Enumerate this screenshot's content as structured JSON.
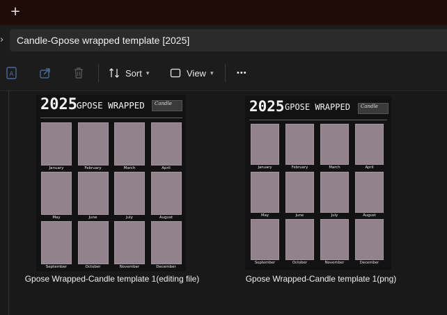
{
  "window": {
    "new_tab_glyph": "+"
  },
  "address": {
    "path": "Candle-Gpose wrapped template [2025]",
    "chevron": "›"
  },
  "toolbar": {
    "icons": [
      "ai-rename-icon",
      "share-icon",
      "delete-icon"
    ],
    "sort_label": "Sort",
    "view_label": "View",
    "more_label": "•••"
  },
  "files": [
    {
      "name": "Gpose Wrapped-Candle template 1(editing file)",
      "thumb": {
        "year": "2025",
        "title": "GPOSE WRAPPED",
        "stamp": "Candle",
        "months": [
          "January",
          "February",
          "March",
          "April",
          "May",
          "June",
          "July",
          "August",
          "September",
          "October",
          "November",
          "December"
        ]
      }
    },
    {
      "name": "Gpose Wrapped-Candle template 1(png)",
      "thumb": {
        "year": "2025",
        "title": "GPOSE WRAPPED",
        "stamp": "Candle",
        "months": [
          "January",
          "February",
          "March",
          "April",
          "May",
          "June",
          "July",
          "August",
          "September",
          "October",
          "November",
          "December"
        ]
      }
    }
  ],
  "colors": {
    "cell": "#92828c",
    "background": "#191919",
    "titlebar": "#1f0b08"
  }
}
